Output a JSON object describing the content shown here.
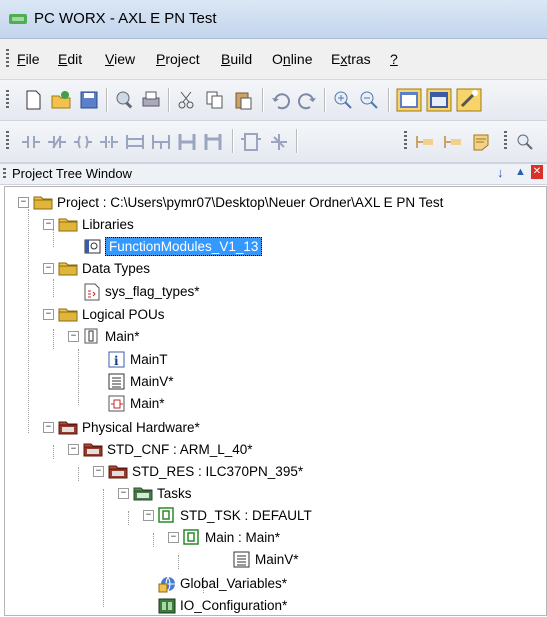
{
  "window": {
    "title": "PC WORX - AXL E PN Test"
  },
  "menu": [
    {
      "prefix": "",
      "key": "F",
      "rest": "ile"
    },
    {
      "prefix": "",
      "key": "E",
      "rest": "dit"
    },
    {
      "prefix": "",
      "key": "V",
      "rest": "iew"
    },
    {
      "prefix": "",
      "key": "P",
      "rest": "roject"
    },
    {
      "prefix": "",
      "key": "B",
      "rest": "uild"
    },
    {
      "prefix": "O",
      "key": "n",
      "rest": "line"
    },
    {
      "prefix": "E",
      "key": "x",
      "rest": "tras"
    },
    {
      "prefix": "",
      "key": "?",
      "rest": ""
    }
  ],
  "panel": {
    "title": "Project Tree Window",
    "pin": "↓",
    "collapse": "▲",
    "close": "✕"
  },
  "tree": {
    "project": "Project : C:\\Users\\pymr07\\Desktop\\Neuer Ordner\\AXL E PN Test",
    "libraries": "Libraries",
    "function_modules": "FunctionModules_V1_13",
    "data_types": "Data Types",
    "sys_flag_types": "sys_flag_types*",
    "logical_pous": "Logical POUs",
    "main": "Main*",
    "main_t": "MainT",
    "main_v": "MainV*",
    "main_code": "Main*",
    "physical_hardware": "Physical Hardware*",
    "std_cnf": "STD_CNF : ARM_L_40*",
    "std_res": "STD_RES : ILC370PN_395*",
    "tasks": "Tasks",
    "std_tsk": "STD_TSK : DEFAULT",
    "main_main": "Main : Main*",
    "main_v2": "MainV*",
    "global_variables": "Global_Variables*",
    "io_configuration": "IO_Configuration*"
  }
}
